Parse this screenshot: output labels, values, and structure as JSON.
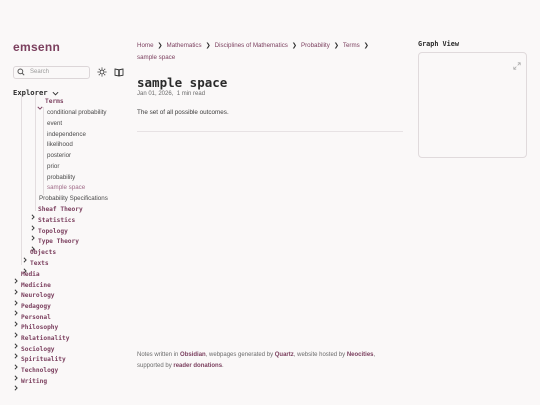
{
  "site": {
    "title": "emsenn"
  },
  "search": {
    "placeholder": "Search"
  },
  "explorer": {
    "label": "Explorer",
    "terms_folder": "Terms",
    "terms_items": [
      "conditional probability",
      "event",
      "independence",
      "likelihood",
      "posterior",
      "prior",
      "probability",
      "sample space"
    ],
    "active_item": "sample space",
    "probability_specs": "Probability Specifications",
    "math_subfolders": [
      "Sheaf Theory",
      "Statistics",
      "Topology",
      "Type Theory"
    ],
    "objects": "Objects",
    "texts": "Texts",
    "top_folders": [
      "Media",
      "Medicine",
      "Neurology",
      "Pedagogy",
      "Personal",
      "Philosophy",
      "Relationality",
      "Sociology",
      "Spirituality",
      "Technology",
      "Writing"
    ]
  },
  "breadcrumb": [
    "Home",
    "Mathematics",
    "Disciplines of Mathematics",
    "Probability",
    "Terms",
    "sample space"
  ],
  "page": {
    "title": "sample space",
    "date": "Jan 01, 2026",
    "read_time": "1 min read",
    "body": "The set of all possible outcomes."
  },
  "footer": {
    "prefix": "Notes written in ",
    "obsidian": "Obsidian",
    "mid1": ", webpages generated by ",
    "quartz": "Quartz",
    "mid2": ", website hosted by ",
    "neocities": "Neocities",
    "mid3": ",",
    "line2_prefix": "supported by ",
    "donations": "reader donations",
    "line2_suffix": "."
  },
  "graph": {
    "title": "Graph View"
  },
  "colors": {
    "accent": "#7b3f5e",
    "background": "#faf8f8",
    "active": "#a06b88"
  }
}
